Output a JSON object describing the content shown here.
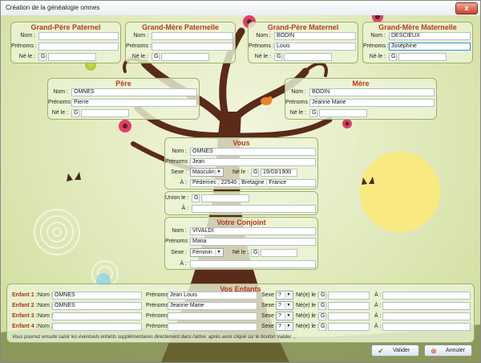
{
  "window": {
    "title": "Création de la généalogie omnes",
    "close_label": "x"
  },
  "grandparents": [
    {
      "title": "Grand-Père Paternel",
      "nom": "",
      "prenoms": "",
      "ne_le": "G"
    },
    {
      "title": "Grand-Mère Paternelle",
      "nom": "",
      "prenoms": "",
      "ne_le": "G"
    },
    {
      "title": "Grand-Père Maternel",
      "nom": "BODIN",
      "prenoms": "Louis",
      "ne_le": "G"
    },
    {
      "title": "Grand-Mère Maternelle",
      "nom": "DESCIEUX",
      "prenoms": "Joséphine",
      "ne_le": "G"
    }
  ],
  "labels": {
    "nom": "Nom :",
    "prenoms": "Prénoms :",
    "ne_le": "Né le :",
    "sexe": "Sexe :",
    "a": "À :",
    "union_le": "Union le :",
    "nee_le": "Né(e) le :"
  },
  "pere": {
    "title": "Père",
    "nom": "OMNES",
    "prenoms": "Pierre",
    "ne_le": "G"
  },
  "mere": {
    "title": "Mère",
    "nom": "BODIN",
    "prenoms": "Jeanne Marie",
    "ne_le": "G"
  },
  "vous": {
    "title": "Vous",
    "nom": "OMNES",
    "prenoms": "Jean",
    "sexe": "Masculin",
    "ne_le_prefix": "G",
    "ne_le": "19/03/1900",
    "a": "Pédernec ; 22540 ; Bretagne ; France"
  },
  "union": {
    "union_le": "G",
    "a": ""
  },
  "conjoint": {
    "title": "Votre Conjoint",
    "nom": "VIVALDI",
    "prenoms": "Maria",
    "sexe": "Féminin",
    "ne_le": "G",
    "a": ""
  },
  "enfants": {
    "title": "Vos Enfants",
    "rows": [
      {
        "label": "Enfant 1 :",
        "nom": "OMNES",
        "prenoms": "Jean Louis",
        "sexe": "?",
        "nee_le": "G",
        "a": ""
      },
      {
        "label": "Enfant 2 :",
        "nom": "OMNES",
        "prenoms": "Jeanne Marie",
        "sexe": "?",
        "nee_le": "G",
        "a": ""
      },
      {
        "label": "Enfant 3 :",
        "nom": "",
        "prenoms": "",
        "sexe": "?",
        "nee_le": "G",
        "a": ""
      },
      {
        "label": "Enfant 4 :",
        "nom": "",
        "prenoms": "",
        "sexe": "?",
        "nee_le": "G",
        "a": ""
      }
    ],
    "hint": "Vous pourrez ensuite saisir les éventuels enfants supplémentaires directement dans l'arbre, après avoir cliqué sur le bouton Valider ..."
  },
  "buttons": {
    "valider": "Valider",
    "annuler": "Annuler"
  },
  "colors": {
    "title_red": "#b83a1a",
    "panel_border": "#9fb06a",
    "trunk": "#5a2a1a",
    "sun": "#fbe97a"
  }
}
